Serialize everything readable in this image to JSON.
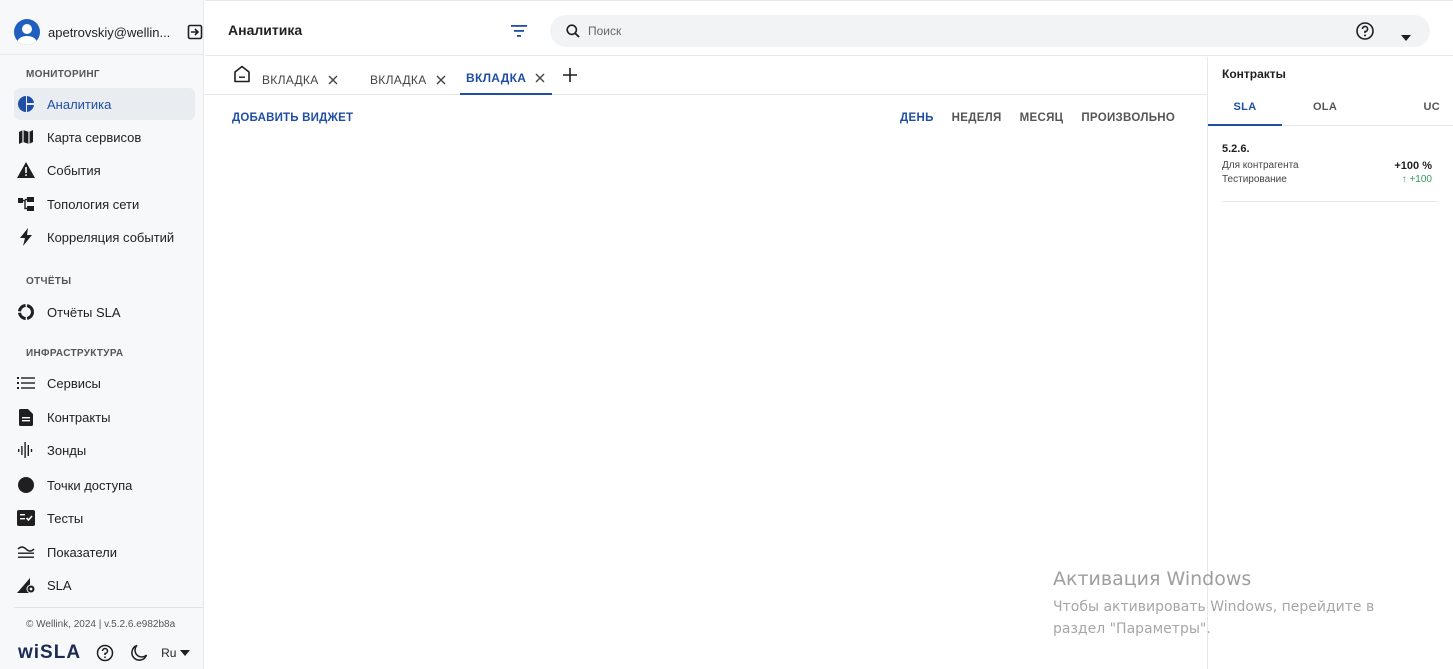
{
  "user": {
    "email": "apetrovskiy@wellin..."
  },
  "sidebar": {
    "sections": {
      "monitoring": "МОНИТОРИНГ",
      "reports": "ОТЧЁТЫ",
      "infra": "ИНФРАСТРУКТУРА"
    },
    "items": [
      {
        "label": "Аналитика",
        "icon": "analytics-icon",
        "active": true
      },
      {
        "label": "Карта сервисов",
        "icon": "map-icon"
      },
      {
        "label": "События",
        "icon": "warning-icon"
      },
      {
        "label": "Топология сети",
        "icon": "topology-icon"
      },
      {
        "label": "Корреляция событий",
        "icon": "lightning-icon"
      },
      {
        "label": "Отчёты SLA",
        "icon": "ring-icon"
      },
      {
        "label": "Сервисы",
        "icon": "list-icon"
      },
      {
        "label": "Контракты",
        "icon": "document-icon"
      },
      {
        "label": "Зонды",
        "icon": "sound-wave-icon"
      },
      {
        "label": "Точки доступа",
        "icon": "circle-icon"
      },
      {
        "label": "Тесты",
        "icon": "checklist-icon"
      },
      {
        "label": "Показатели",
        "icon": "approx-icon"
      },
      {
        "label": "SLA",
        "icon": "sla-gear-icon"
      }
    ],
    "footer": {
      "copyright": "© Wellink, 2024 | v.5.2.6.e982b8a",
      "brand": "wiSLA",
      "lang": "Ru"
    }
  },
  "header": {
    "title": "Аналитика",
    "search_placeholder": "Поиск"
  },
  "tabs": [
    {
      "label": "ВКЛАДКА",
      "active": false
    },
    {
      "label": "ВКЛАДКА",
      "active": false
    },
    {
      "label": "ВКЛАДКА",
      "active": true
    }
  ],
  "toolbar": {
    "add_widget": "ДОБАВИТЬ ВИДЖЕТ",
    "periods": [
      {
        "label": "ДЕНЬ",
        "active": true
      },
      {
        "label": "НЕДЕЛЯ",
        "active": false
      },
      {
        "label": "МЕСЯЦ",
        "active": false
      },
      {
        "label": "ПРОИЗВОЛЬНО",
        "active": false
      }
    ]
  },
  "right_panel": {
    "title": "Контракты",
    "tabs": [
      {
        "label": "SLA",
        "active": true
      },
      {
        "label": "OLA",
        "active": false
      },
      {
        "label": "UC",
        "active": false
      }
    ],
    "contract": {
      "version": "5.2.6.",
      "line1_label": "Для контрагента",
      "line1_value": "+100 %",
      "line2_label": "Тестирование",
      "line2_value": "↑ +100"
    }
  },
  "watermark": {
    "title": "Активация Windows",
    "text": "Чтобы активировать Windows, перейдите в раздел \"Параметры\"."
  },
  "colors": {
    "accent": "#1f4ea3",
    "positive": "#2e9e5b",
    "sidebar_bg": "#f7f8fa"
  }
}
